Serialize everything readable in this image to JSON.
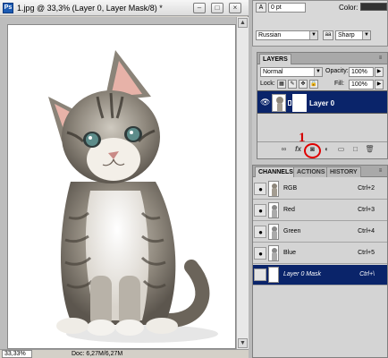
{
  "document": {
    "title": "1.jpg @ 33,3% (Layer 0, Layer Mask/8) *",
    "app_badge": "Ps",
    "window_buttons": {
      "minimize": "–",
      "maximize": "□",
      "close": "×"
    },
    "zoom": "33,33%",
    "doc_size": "Doc: 6,27M/6,27M"
  },
  "character": {
    "size_value": "0 pt",
    "color_label": "Color:",
    "font_value": "Russian",
    "aa_icon": "aa",
    "antialias_value": "Sharp",
    "color_swatch": "#333333"
  },
  "layers": {
    "tab_label": "LAYERS",
    "blend_mode": "Normal",
    "opacity_label": "Opacity:",
    "opacity_value": "100%",
    "lock_label": "Lock:",
    "fill_label": "Fill:",
    "fill_value": "100%",
    "layer_name": "Layer 0",
    "annotation_number": "1",
    "toolbar_icons": [
      "link-icon",
      "fx-icon",
      "add-mask-icon",
      "adjustment-icon",
      "group-icon",
      "new-layer-icon",
      "trash-icon"
    ]
  },
  "channels": {
    "tabs": [
      "CHANNELS",
      "ACTIONS",
      "HISTORY"
    ],
    "active_tab": "CHANNELS",
    "rows": [
      {
        "name": "RGB",
        "shortcut": "Ctrl+2"
      },
      {
        "name": "Red",
        "shortcut": "Ctrl+3"
      },
      {
        "name": "Green",
        "shortcut": "Ctrl+4"
      },
      {
        "name": "Blue",
        "shortcut": "Ctrl+5"
      },
      {
        "name": "Layer 0 Mask",
        "shortcut": "Ctrl+\\"
      }
    ]
  }
}
